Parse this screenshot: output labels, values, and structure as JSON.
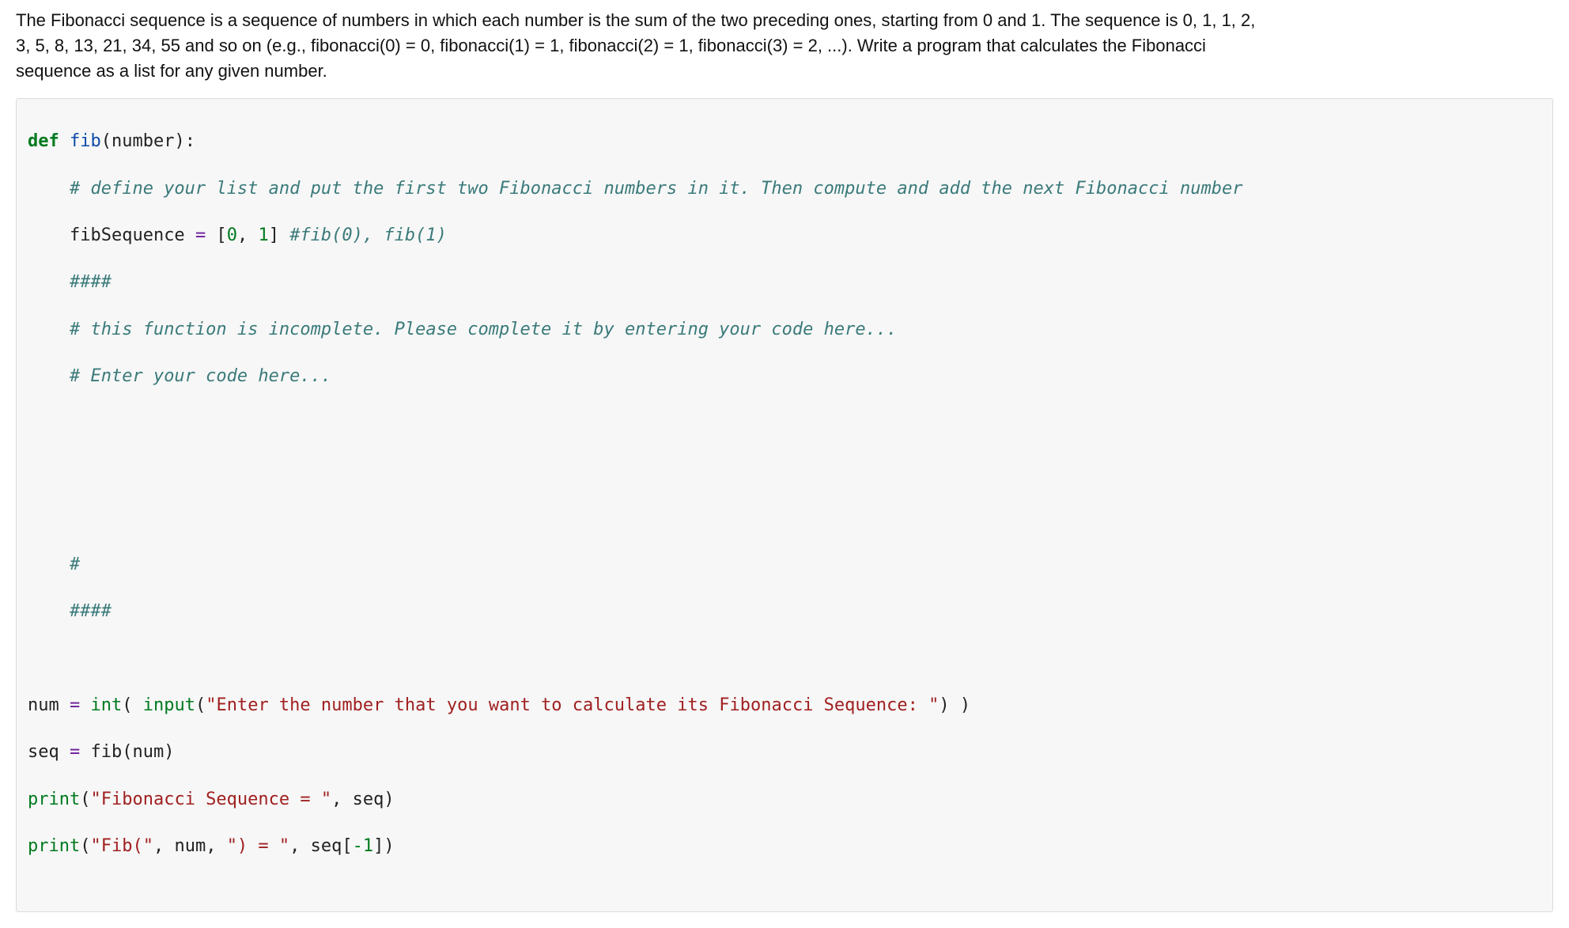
{
  "problem": {
    "description": "The Fibonacci sequence is a sequence of numbers in which each number is the sum of the two preceding ones, starting from 0 and 1. The sequence is 0, 1, 1, 2, 3, 5, 8, 13, 21, 34, 55 and so on (e.g., fibonacci(0) = 0, fibonacci(1) = 1, fibonacci(2) = 1, fibonacci(3) = 2, ...). Write a program that calculates the Fibonacci sequence as a list for any given number."
  },
  "code": {
    "l1_keyword": "def",
    "l1_space": " ",
    "l1_funcname": "fib",
    "l1_after": "(number):",
    "l2_indent": "    ",
    "l2_comment": "# define your list and put the first two Fibonacci numbers in it. Then compute and add the next Fibonacci number",
    "l3_indent": "    ",
    "l3_before_eq": "fibSequence ",
    "l3_eq": "=",
    "l3_after_eq": " [",
    "l3_num0": "0",
    "l3_comma": ", ",
    "l3_num1": "1",
    "l3_end": "] ",
    "l3_comment": "#fib(0), fib(1)",
    "l4_indent": "    ",
    "l4_comment": "####",
    "l5_indent": "    ",
    "l5_comment": "# this function is incomplete. Please complete it by entering your code here...",
    "l6_indent": "    ",
    "l6_comment": "# Enter your code here...",
    "blank": "",
    "l9_indent": "    ",
    "l9_comment": "#",
    "l10_indent": "    ",
    "l10_comment": "####",
    "l12_pre": "num ",
    "l12_eq": "=",
    "l12_sp": " ",
    "l12_int": "int",
    "l12_paren_open": "( ",
    "l12_input": "input",
    "l12_paren2_open": "(",
    "l12_string": "\"Enter the number that you want to calculate its Fibonacci Sequence: \"",
    "l12_paren_close": ") )",
    "l13_pre": "seq ",
    "l13_eq": "=",
    "l13_after": " fib(num)",
    "l14_print": "print",
    "l14_open": "(",
    "l14_str": "\"Fibonacci Sequence = \"",
    "l14_rest": ", seq)",
    "l15_print": "print",
    "l15_open": "(",
    "l15_str1": "\"Fib(\"",
    "l15_mid1": ", num, ",
    "l15_str2": "\") = \"",
    "l15_mid2": ", seq[",
    "l15_neg1": "-1",
    "l15_end": "])"
  }
}
